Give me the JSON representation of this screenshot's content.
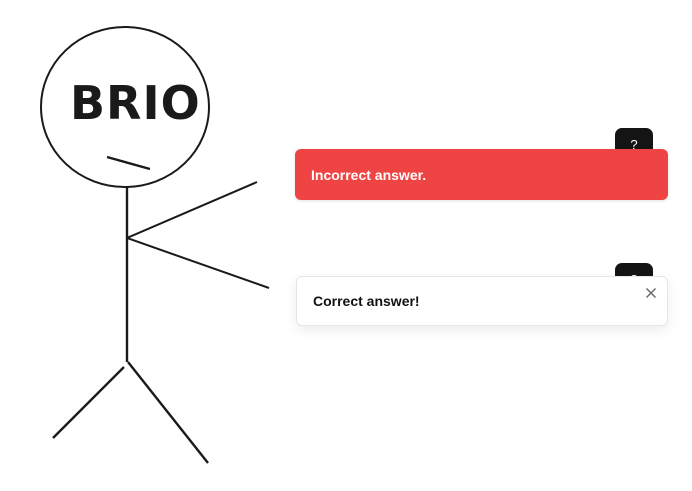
{
  "drawing": {
    "label": "BRIO"
  },
  "help_buttons": [
    {
      "label": "?"
    },
    {
      "label": "?"
    }
  ],
  "toasts": {
    "error": {
      "message": "Incorrect answer.",
      "color": "#ef4444"
    },
    "success": {
      "message": "Correct answer!",
      "close_icon": "close-icon"
    }
  }
}
